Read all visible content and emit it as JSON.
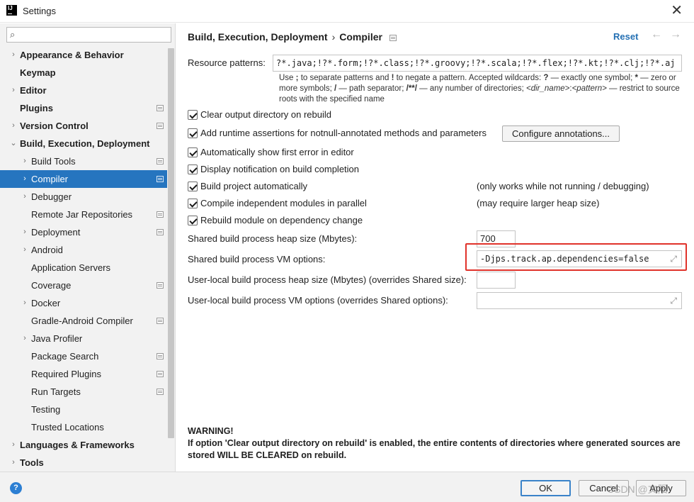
{
  "window": {
    "title": "Settings",
    "app_icon": "IJ"
  },
  "sidebar": {
    "search_placeholder": "",
    "items": [
      {
        "label": "Appearance & Behavior",
        "level": 0,
        "arrow": "›",
        "bold": true,
        "icon": false,
        "selected": false
      },
      {
        "label": "Keymap",
        "level": 0,
        "arrow": "",
        "bold": true,
        "icon": false,
        "selected": false
      },
      {
        "label": "Editor",
        "level": 0,
        "arrow": "›",
        "bold": true,
        "icon": false,
        "selected": false
      },
      {
        "label": "Plugins",
        "level": 0,
        "arrow": "",
        "bold": true,
        "icon": true,
        "selected": false
      },
      {
        "label": "Version Control",
        "level": 0,
        "arrow": "›",
        "bold": true,
        "icon": true,
        "selected": false
      },
      {
        "label": "Build, Execution, Deployment",
        "level": 0,
        "arrow": "⌄",
        "bold": true,
        "icon": false,
        "selected": false
      },
      {
        "label": "Build Tools",
        "level": 1,
        "arrow": "›",
        "bold": false,
        "icon": true,
        "selected": false
      },
      {
        "label": "Compiler",
        "level": 1,
        "arrow": "›",
        "bold": false,
        "icon": true,
        "selected": true
      },
      {
        "label": "Debugger",
        "level": 1,
        "arrow": "›",
        "bold": false,
        "icon": false,
        "selected": false
      },
      {
        "label": "Remote Jar Repositories",
        "level": 1,
        "arrow": "",
        "bold": false,
        "icon": true,
        "selected": false
      },
      {
        "label": "Deployment",
        "level": 1,
        "arrow": "›",
        "bold": false,
        "icon": true,
        "selected": false
      },
      {
        "label": "Android",
        "level": 1,
        "arrow": "›",
        "bold": false,
        "icon": false,
        "selected": false
      },
      {
        "label": "Application Servers",
        "level": 1,
        "arrow": "",
        "bold": false,
        "icon": false,
        "selected": false
      },
      {
        "label": "Coverage",
        "level": 1,
        "arrow": "",
        "bold": false,
        "icon": true,
        "selected": false
      },
      {
        "label": "Docker",
        "level": 1,
        "arrow": "›",
        "bold": false,
        "icon": false,
        "selected": false
      },
      {
        "label": "Gradle-Android Compiler",
        "level": 1,
        "arrow": "",
        "bold": false,
        "icon": true,
        "selected": false
      },
      {
        "label": "Java Profiler",
        "level": 1,
        "arrow": "›",
        "bold": false,
        "icon": false,
        "selected": false
      },
      {
        "label": "Package Search",
        "level": 1,
        "arrow": "",
        "bold": false,
        "icon": true,
        "selected": false
      },
      {
        "label": "Required Plugins",
        "level": 1,
        "arrow": "",
        "bold": false,
        "icon": true,
        "selected": false
      },
      {
        "label": "Run Targets",
        "level": 1,
        "arrow": "",
        "bold": false,
        "icon": true,
        "selected": false
      },
      {
        "label": "Testing",
        "level": 1,
        "arrow": "",
        "bold": false,
        "icon": false,
        "selected": false
      },
      {
        "label": "Trusted Locations",
        "level": 1,
        "arrow": "",
        "bold": false,
        "icon": false,
        "selected": false
      },
      {
        "label": "Languages & Frameworks",
        "level": 0,
        "arrow": "›",
        "bold": true,
        "icon": false,
        "selected": false
      },
      {
        "label": "Tools",
        "level": 0,
        "arrow": "›",
        "bold": true,
        "icon": false,
        "selected": false
      }
    ]
  },
  "header": {
    "crumb1": "Build, Execution, Deployment",
    "separator": "›",
    "crumb2": "Compiler",
    "reset": "Reset",
    "back": "←",
    "forward": "→"
  },
  "resource": {
    "label": "Resource patterns:",
    "value": "?*.java;!?*.form;!?*.class;!?*.groovy;!?*.scala;!?*.flex;!?*.kt;!?*.clj;!?*.aj",
    "hint": {
      "t1": "Use ",
      "b1": ";",
      "t2": " to separate patterns and ",
      "b2": "!",
      "t3": " to negate a pattern. Accepted wildcards: ",
      "b3": "?",
      "t4": " — exactly one symbol; ",
      "b4": "*",
      "t5": " — zero or more symbols; ",
      "b5": "/",
      "t6": " — path separator; ",
      "b6": "/**/",
      "t7": " — any number of directories; ",
      "i1": "<dir_name>",
      "t8": ":",
      "i2": "<pattern>",
      "t9": " — restrict to source roots with the specified name"
    }
  },
  "options": {
    "clear_output": "Clear output directory on rebuild",
    "runtime_assertions": "Add runtime assertions for notnull-annotated methods and parameters",
    "configure_annotations": "Configure annotations...",
    "show_first_error": "Automatically show first error in editor",
    "display_notification": "Display notification on build completion",
    "build_automatically": "Build project automatically",
    "build_automatically_note": "(only works while not running / debugging)",
    "compile_parallel": "Compile independent modules in parallel",
    "compile_parallel_note": "(may require larger heap size)",
    "rebuild_dependency": "Rebuild module on dependency change"
  },
  "fields": {
    "heap_label": "Shared build process heap size (Mbytes):",
    "heap_value": "700",
    "vm_label": "Shared build process VM options:",
    "vm_value": "-Djps.track.ap.dependencies=false",
    "local_heap_label": "User-local build process heap size (Mbytes) (overrides Shared size):",
    "local_heap_value": "",
    "local_vm_label": "User-local build process VM options (overrides Shared options):",
    "local_vm_value": ""
  },
  "warning": {
    "title": "WARNING!",
    "body": "If option 'Clear output directory on rebuild' is enabled, the entire contents of directories where generated sources are stored WILL BE CLEARED on rebuild."
  },
  "footer": {
    "help": "?",
    "ok": "OK",
    "cancel": "Cancel",
    "apply": "Apply",
    "watermark": "CSDN @文阳"
  },
  "colors": {
    "selection": "#2675bf",
    "link": "#2470b3",
    "highlight": "#e0322a"
  }
}
